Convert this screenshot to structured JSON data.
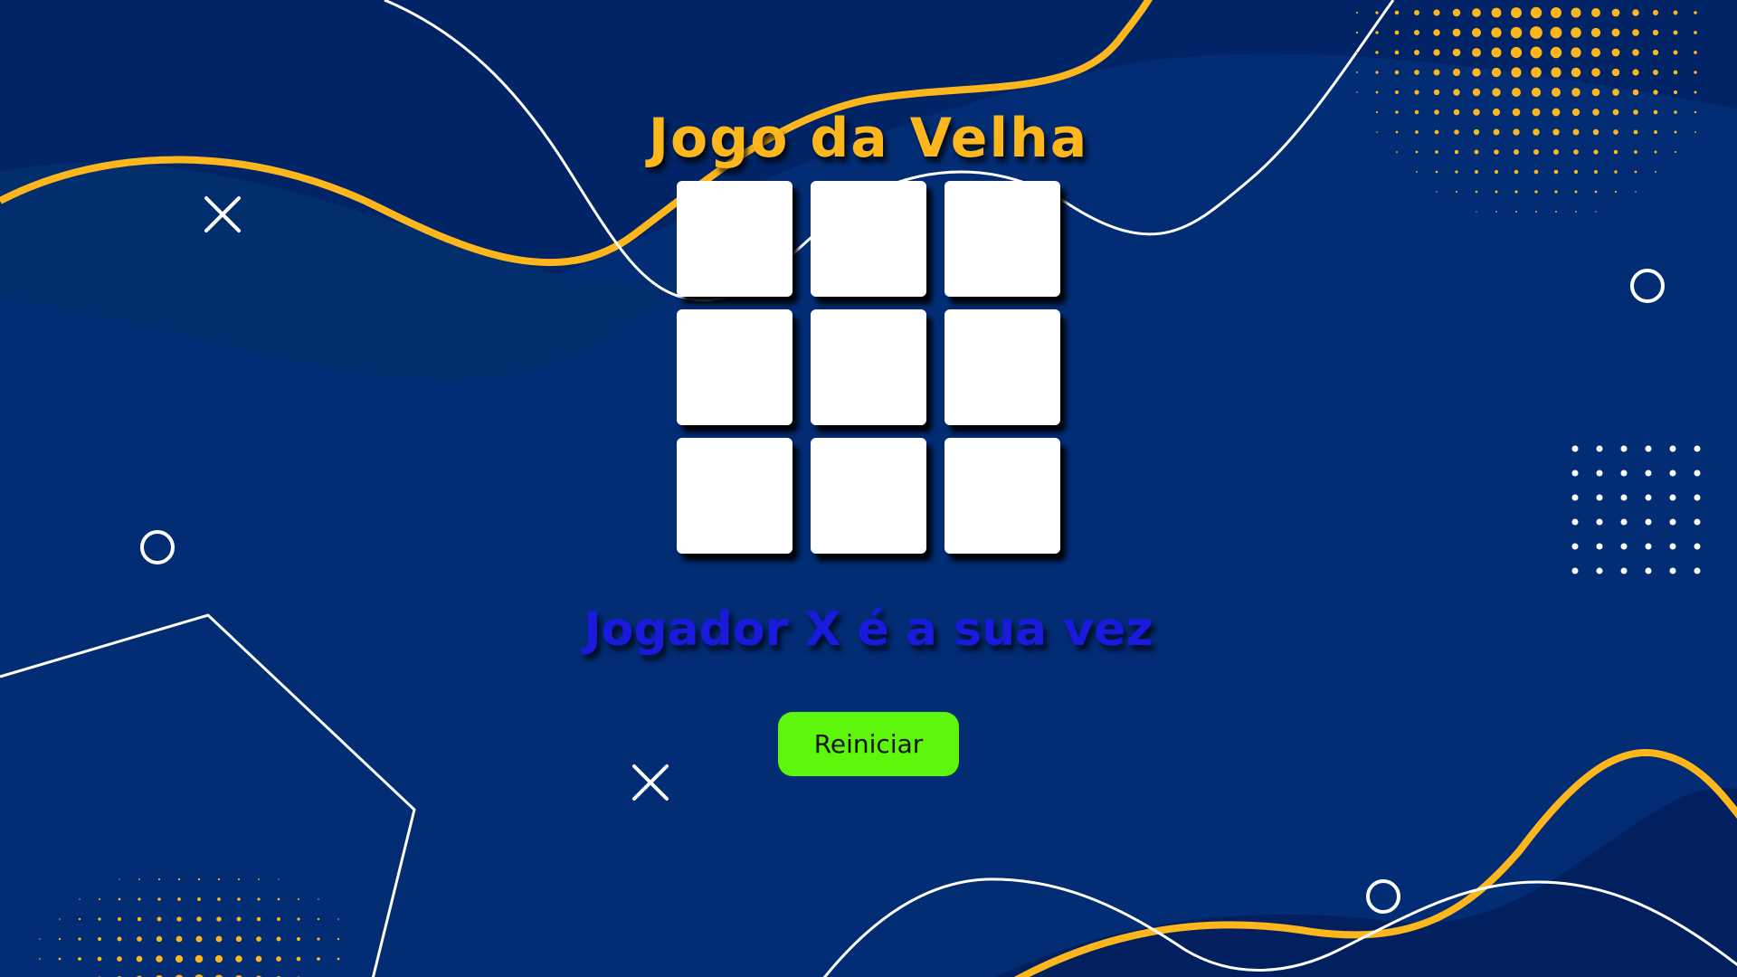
{
  "colors": {
    "background": "#022c74",
    "background_dark": "#021f5c",
    "accent_yellow": "#fdb71c",
    "line_white": "#ffffff",
    "cell_background": "#ffffff",
    "status_text": "#1a1adc",
    "button_background": "#5cf70a",
    "button_text": "#111111"
  },
  "game": {
    "title": "Jogo da Velha",
    "status": "Jogador X é a sua vez",
    "restart_label": "Reiniciar",
    "board": [
      "",
      "",
      "",
      "",
      "",
      "",
      "",
      "",
      ""
    ]
  },
  "decorations": {
    "cross_icon_count": 2,
    "ring_icon_count": 3
  }
}
